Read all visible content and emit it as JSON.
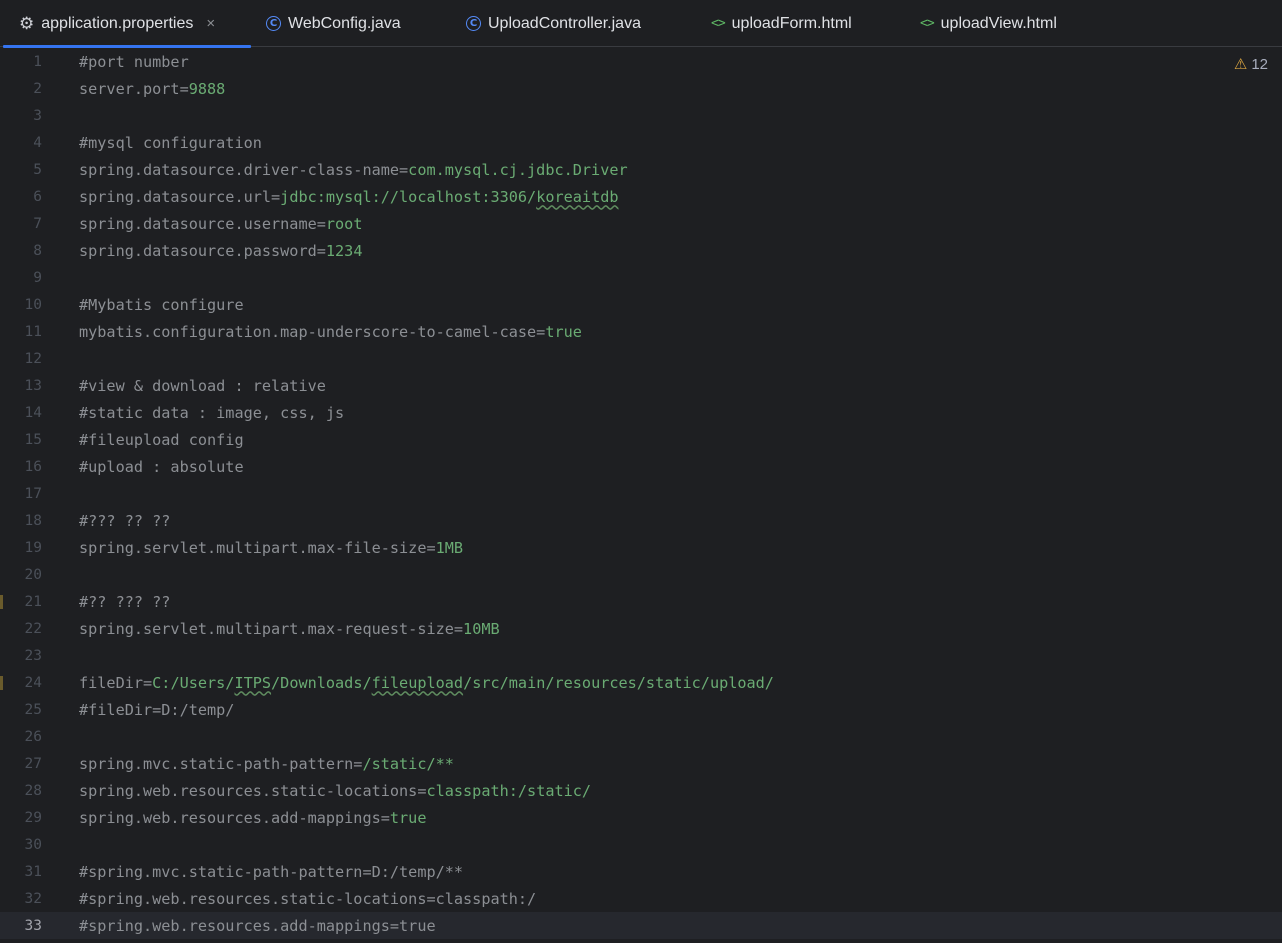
{
  "tabs": [
    {
      "label": "application.properties",
      "icon": "gear-icon",
      "active": true
    },
    {
      "label": "WebConfig.java",
      "icon": "class-icon"
    },
    {
      "label": "UploadController.java",
      "icon": "class-icon"
    },
    {
      "label": "uploadForm.html",
      "icon": "html-icon"
    },
    {
      "label": "uploadView.html",
      "icon": "html-icon"
    }
  ],
  "close_glyph": "×",
  "inspection": {
    "warning_count": "12"
  },
  "current_line": "33",
  "lines": [
    {
      "n": "1",
      "parts": [
        {
          "t": "#port number",
          "c": "cm"
        }
      ]
    },
    {
      "n": "2",
      "parts": [
        {
          "t": "server.port=",
          "c": "k"
        },
        {
          "t": "9888",
          "c": "v"
        }
      ]
    },
    {
      "n": "3",
      "parts": []
    },
    {
      "n": "4",
      "parts": [
        {
          "t": "#mysql configuration",
          "c": "cm"
        }
      ]
    },
    {
      "n": "5",
      "parts": [
        {
          "t": "spring.datasource.driver-class-name=",
          "c": "k"
        },
        {
          "t": "com.mysql.cj.jdbc.Driver",
          "c": "v"
        }
      ]
    },
    {
      "n": "6",
      "parts": [
        {
          "t": "spring.datasource.url=",
          "c": "k"
        },
        {
          "t": "jdbc:mysql://localhost:3306/",
          "c": "v"
        },
        {
          "t": "koreaitdb",
          "c": "v typo"
        }
      ]
    },
    {
      "n": "7",
      "parts": [
        {
          "t": "spring.datasource.username=",
          "c": "k"
        },
        {
          "t": "root",
          "c": "v"
        }
      ]
    },
    {
      "n": "8",
      "parts": [
        {
          "t": "spring.datasource.password=",
          "c": "k"
        },
        {
          "t": "1234",
          "c": "v"
        }
      ]
    },
    {
      "n": "9",
      "parts": []
    },
    {
      "n": "10",
      "parts": [
        {
          "t": "#Mybatis configure",
          "c": "cm"
        }
      ]
    },
    {
      "n": "11",
      "parts": [
        {
          "t": "mybatis.configuration.map-underscore-to-camel-case=",
          "c": "k"
        },
        {
          "t": "true",
          "c": "v"
        }
      ]
    },
    {
      "n": "12",
      "parts": []
    },
    {
      "n": "13",
      "parts": [
        {
          "t": "#view & download : relative",
          "c": "cm"
        }
      ]
    },
    {
      "n": "14",
      "parts": [
        {
          "t": "#static data : image, css, js",
          "c": "cm"
        }
      ]
    },
    {
      "n": "15",
      "parts": [
        {
          "t": "#fileupload config",
          "c": "cm"
        }
      ]
    },
    {
      "n": "16",
      "parts": [
        {
          "t": "#upload : absolute",
          "c": "cm"
        }
      ]
    },
    {
      "n": "17",
      "parts": []
    },
    {
      "n": "18",
      "parts": [
        {
          "t": "#??? ?? ??",
          "c": "cm"
        }
      ]
    },
    {
      "n": "19",
      "parts": [
        {
          "t": "spring.servlet.multipart.max-file-size=",
          "c": "k"
        },
        {
          "t": "1MB",
          "c": "v"
        }
      ]
    },
    {
      "n": "20",
      "parts": []
    },
    {
      "n": "21",
      "parts": [
        {
          "t": "#?? ??? ??",
          "c": "cm"
        }
      ]
    },
    {
      "n": "22",
      "parts": [
        {
          "t": "spring.servlet.multipart.max-request-size=",
          "c": "k"
        },
        {
          "t": "10MB",
          "c": "v"
        }
      ]
    },
    {
      "n": "23",
      "parts": []
    },
    {
      "n": "24",
      "parts": [
        {
          "t": "fileDir=",
          "c": "k"
        },
        {
          "t": "C:/Users/",
          "c": "v"
        },
        {
          "t": "ITPS",
          "c": "v typo"
        },
        {
          "t": "/Downloads/",
          "c": "v"
        },
        {
          "t": "fileupload",
          "c": "v typo"
        },
        {
          "t": "/src/main/resources/static/upload/",
          "c": "v"
        }
      ]
    },
    {
      "n": "25",
      "parts": [
        {
          "t": "#fileDir=D:/temp/",
          "c": "cm"
        }
      ]
    },
    {
      "n": "26",
      "parts": []
    },
    {
      "n": "27",
      "parts": [
        {
          "t": "spring.mvc.static-path-pattern=",
          "c": "k"
        },
        {
          "t": "/static/**",
          "c": "v"
        }
      ]
    },
    {
      "n": "28",
      "parts": [
        {
          "t": "spring.web.resources.static-locations=",
          "c": "k"
        },
        {
          "t": "classpath:/static/",
          "c": "v"
        }
      ]
    },
    {
      "n": "29",
      "parts": [
        {
          "t": "spring.web.resources.add-mappings=",
          "c": "k"
        },
        {
          "t": "true",
          "c": "v"
        }
      ]
    },
    {
      "n": "30",
      "parts": []
    },
    {
      "n": "31",
      "parts": [
        {
          "t": "#spring.mvc.static-path-pattern=D:/temp/**",
          "c": "cm"
        }
      ]
    },
    {
      "n": "32",
      "parts": [
        {
          "t": "#spring.web.resources.static-locations=classpath:/",
          "c": "cm"
        }
      ]
    },
    {
      "n": "33",
      "parts": [
        {
          "t": "#spring.web.resources.add-mappings=true",
          "c": "cm"
        }
      ]
    }
  ],
  "colors": {
    "accent": "#3574f0",
    "value": "#6aab73",
    "key": "#8c8f94",
    "background": "#1e1f22",
    "warning": "#d9a441"
  }
}
